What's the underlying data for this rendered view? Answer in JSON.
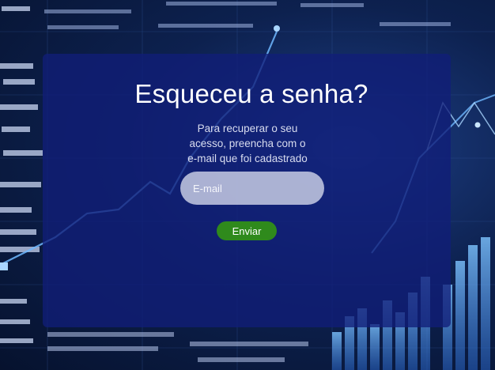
{
  "reset": {
    "title": "Esqueceu a senha?",
    "description_lines": [
      "Para recuperar o seu",
      "acesso, preencha com o",
      "e-mail que foi cadastrado"
    ],
    "email_placeholder": "E-mail",
    "email_value": "",
    "submit_label": "Enviar"
  },
  "colors": {
    "panel": "#111e78",
    "button": "#2f8a1c",
    "input": "#cdd2e8",
    "chart_line": "#6fb8ff"
  }
}
